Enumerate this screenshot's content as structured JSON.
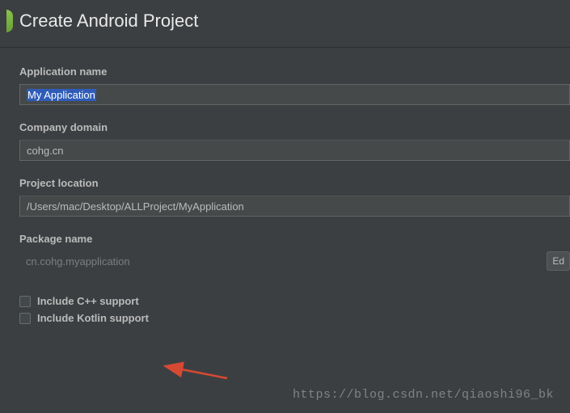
{
  "header": {
    "title": "Create Android Project"
  },
  "fields": {
    "appName": {
      "label": "Application name",
      "value": "My Application"
    },
    "companyDomain": {
      "label": "Company domain",
      "value": "cohg.cn"
    },
    "projectLocation": {
      "label": "Project location",
      "value": "/Users/mac/Desktop/ALLProject/MyApplication"
    },
    "packageName": {
      "label": "Package name",
      "value": "cn.cohg.myapplication",
      "editButton": "Ed"
    }
  },
  "checkboxes": {
    "cpp": "Include C++ support",
    "kotlin": "Include Kotlin support"
  },
  "watermark": "https://blog.csdn.net/qiaoshi96_bk"
}
